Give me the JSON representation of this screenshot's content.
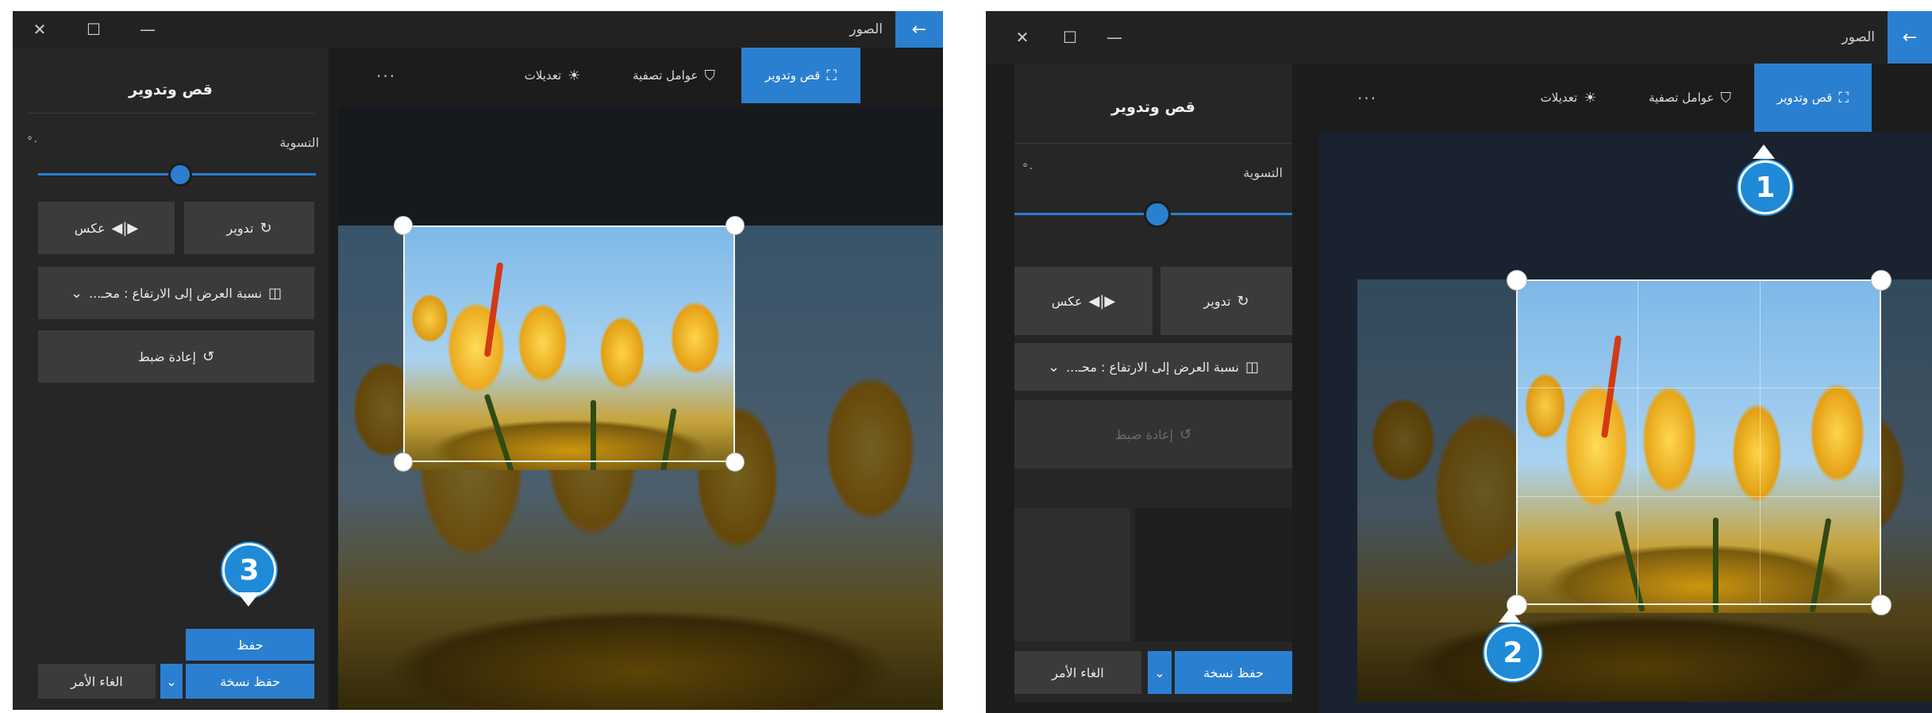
{
  "app_title": "الصور",
  "window_controls": {
    "close": "✕",
    "maximize": "☐",
    "minimize": "—",
    "back": "←"
  },
  "toolbar": {
    "crop_rotate": "قص وتدوير",
    "filters": "عوامل تصفية",
    "adjustments": "تعديلات",
    "more": "..."
  },
  "panel": {
    "title": "قص وتدوير",
    "straighten_label": "التسوية",
    "straighten_value": "°٠",
    "rotate": "تدوير",
    "flip": "عكس",
    "aspect_ratio": "نسبة العرض إلى الارتفاع : محـ...",
    "reset": "إعادة ضبط",
    "save": "حفظ",
    "save_copy": "حفظ نسخة",
    "cancel": "الغاء الأمر"
  },
  "callouts": {
    "one": "1",
    "two": "2",
    "three": "3"
  },
  "colors": {
    "accent": "#2b7fd0",
    "callout": "#1f8ad8",
    "window_bg": "#1c1c1c",
    "panel_bg": "#262626"
  },
  "icons": {
    "crop": "crop-icon",
    "filters": "filter-icon",
    "adjust": "sun-icon",
    "rotate": "rotate-icon",
    "flip": "flip-icon",
    "aspect": "aspect-ratio-icon",
    "reset": "reset-icon",
    "chevron": "chevron-down-icon"
  },
  "windows": [
    {
      "id": "left",
      "slider_value_percent": 50
    },
    {
      "id": "right",
      "slider_value_percent": 50
    }
  ]
}
